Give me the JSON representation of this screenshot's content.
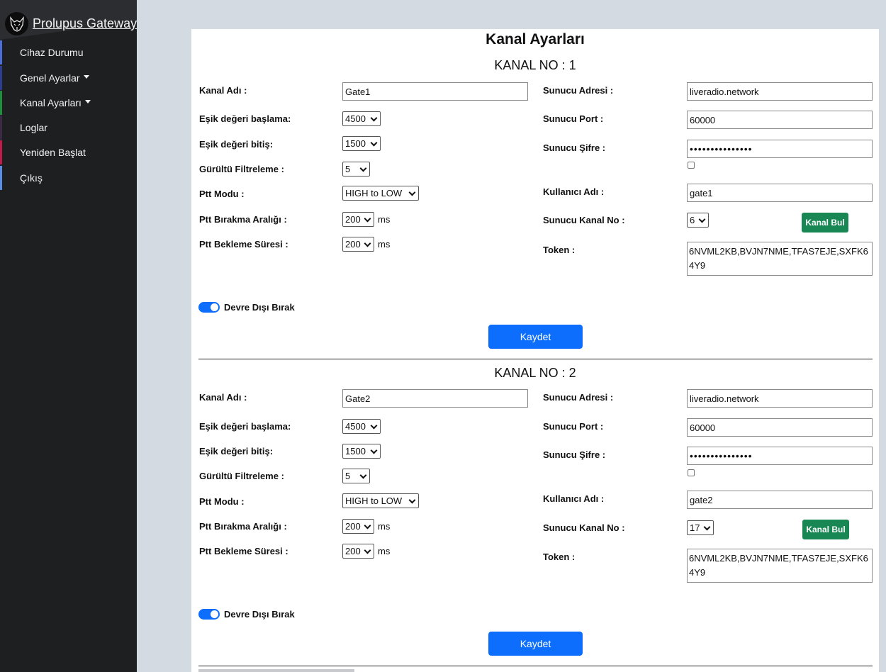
{
  "app": {
    "title": "Prolupus Gateway"
  },
  "sidebar": {
    "items": [
      {
        "label": "Cihaz Durumu",
        "accent": "#4a6fd6",
        "dropdown": false
      },
      {
        "label": "Genel Ayarlar",
        "accent": "#2c3e8f",
        "dropdown": true
      },
      {
        "label": "Kanal Ayarları",
        "accent": "#1e8f3a",
        "dropdown": true
      },
      {
        "label": "Loglar",
        "accent": "#3a2a44",
        "dropdown": false
      },
      {
        "label": "Yeniden Başlat",
        "accent": "#c2184a",
        "dropdown": false
      },
      {
        "label": "Çıkış",
        "accent": "#5a8ee6",
        "dropdown": false
      }
    ]
  },
  "page": {
    "title": "Kanal Ayarları"
  },
  "labels": {
    "kanal_adi": "Kanal Adı :",
    "esik_baslama": "Eşik değeri başlama:",
    "esik_bitis": "Eşik değeri bitiş:",
    "gurultu": "Gürültü Filtreleme :",
    "ptt_modu": "Ptt Modu :",
    "ptt_birakma": "Ptt Bırakma Aralığı :",
    "ptt_bekleme": "Ptt Bekleme Süresi :",
    "sunucu_adresi": "Sunucu Adresi :",
    "sunucu_port": "Sunucu Port :",
    "sunucu_sifre": "Sunucu Şifre :",
    "kullanici_adi": "Kullanıcı Adı :",
    "sunucu_kanal_no": "Sunucu Kanal No :",
    "token": "Token :",
    "unit_ms": "ms",
    "disable": "Devre Dışı Bırak",
    "find_channel": "Kanal Bul",
    "save": "Kaydet"
  },
  "channels": [
    {
      "title": "KANAL NO : 1",
      "kanal_adi": "Gate1",
      "esik_baslama": "4500",
      "esik_bitis": "1500",
      "gurultu": "5",
      "ptt_modu": "HIGH to LOW",
      "ptt_birakma": "200",
      "ptt_bekleme": "200",
      "sunucu_adresi": "liveradio.network",
      "sunucu_port": "60000",
      "sunucu_sifre": "•••••••••••••••",
      "show_password": false,
      "kullanici_adi": "gate1",
      "sunucu_kanal_no": "6",
      "token": "6NVML2KB,BVJN7NME,TFAS7EJE,SXFK64Y9",
      "disabled_toggle": true
    },
    {
      "title": "KANAL NO : 2",
      "kanal_adi": "Gate2",
      "esik_baslama": "4500",
      "esik_bitis": "1500",
      "gurultu": "5",
      "ptt_modu": "HIGH to LOW",
      "ptt_birakma": "200",
      "ptt_bekleme": "200",
      "sunucu_adresi": "liveradio.network",
      "sunucu_port": "60000",
      "sunucu_sifre": "•••••••••••••••",
      "show_password": false,
      "kullanici_adi": "gate2",
      "sunucu_kanal_no": "17",
      "token": "6NVML2KB,BVJN7NME,TFAS7EJE,SXFK64Y9",
      "disabled_toggle": true
    }
  ],
  "colors": {
    "primary": "#0d6efd",
    "success": "#198754",
    "sidebar": "#1e1f21"
  }
}
